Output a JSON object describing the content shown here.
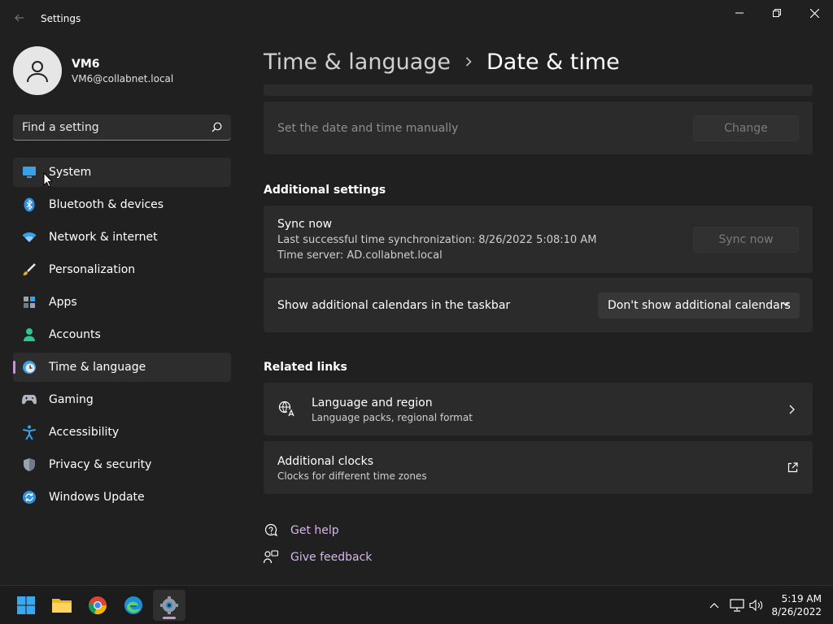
{
  "window": {
    "title": "Settings"
  },
  "user": {
    "name": "VM6",
    "email": "VM6@collabnet.local"
  },
  "search": {
    "placeholder": "Find a setting"
  },
  "nav": {
    "items": [
      {
        "label": "System",
        "icon": "monitor-icon"
      },
      {
        "label": "Bluetooth & devices",
        "icon": "bluetooth-icon"
      },
      {
        "label": "Network & internet",
        "icon": "wifi-icon"
      },
      {
        "label": "Personalization",
        "icon": "brush-icon"
      },
      {
        "label": "Apps",
        "icon": "apps-icon"
      },
      {
        "label": "Accounts",
        "icon": "person-icon"
      },
      {
        "label": "Time & language",
        "icon": "clock-globe-icon"
      },
      {
        "label": "Gaming",
        "icon": "gamepad-icon"
      },
      {
        "label": "Accessibility",
        "icon": "accessibility-icon"
      },
      {
        "label": "Privacy & security",
        "icon": "shield-icon"
      },
      {
        "label": "Windows Update",
        "icon": "update-icon"
      }
    ],
    "active": "Time & language",
    "hovered": "System"
  },
  "breadcrumb": {
    "parent": "Time & language",
    "current": "Date & time"
  },
  "manual": {
    "label": "Set the date and time manually",
    "button": "Change"
  },
  "additional": {
    "title": "Additional settings",
    "sync": {
      "title": "Sync now",
      "last_sync": "Last successful time synchronization: 8/26/2022 5:08:10 AM",
      "server": "Time server: AD.collabnet.local",
      "button": "Sync now"
    },
    "calendars": {
      "label": "Show additional calendars in the taskbar",
      "value": "Don't show additional calendars"
    }
  },
  "related": {
    "title": "Related links",
    "language_region": {
      "title": "Language and region",
      "subtitle": "Language packs, regional format"
    },
    "clocks": {
      "title": "Additional clocks",
      "subtitle": "Clocks for different time zones"
    }
  },
  "help": {
    "get_help": "Get help",
    "feedback": "Give feedback"
  },
  "taskbar": {
    "apps": [
      "start-icon",
      "file-explorer-icon",
      "chrome-icon",
      "edge-icon",
      "settings-icon"
    ],
    "time": "5:19 AM",
    "date": "8/26/2022"
  },
  "colors": {
    "accent": "#c496d6",
    "link": "#d9b4ec",
    "background": "#202020",
    "card": "#2b2b2b"
  }
}
